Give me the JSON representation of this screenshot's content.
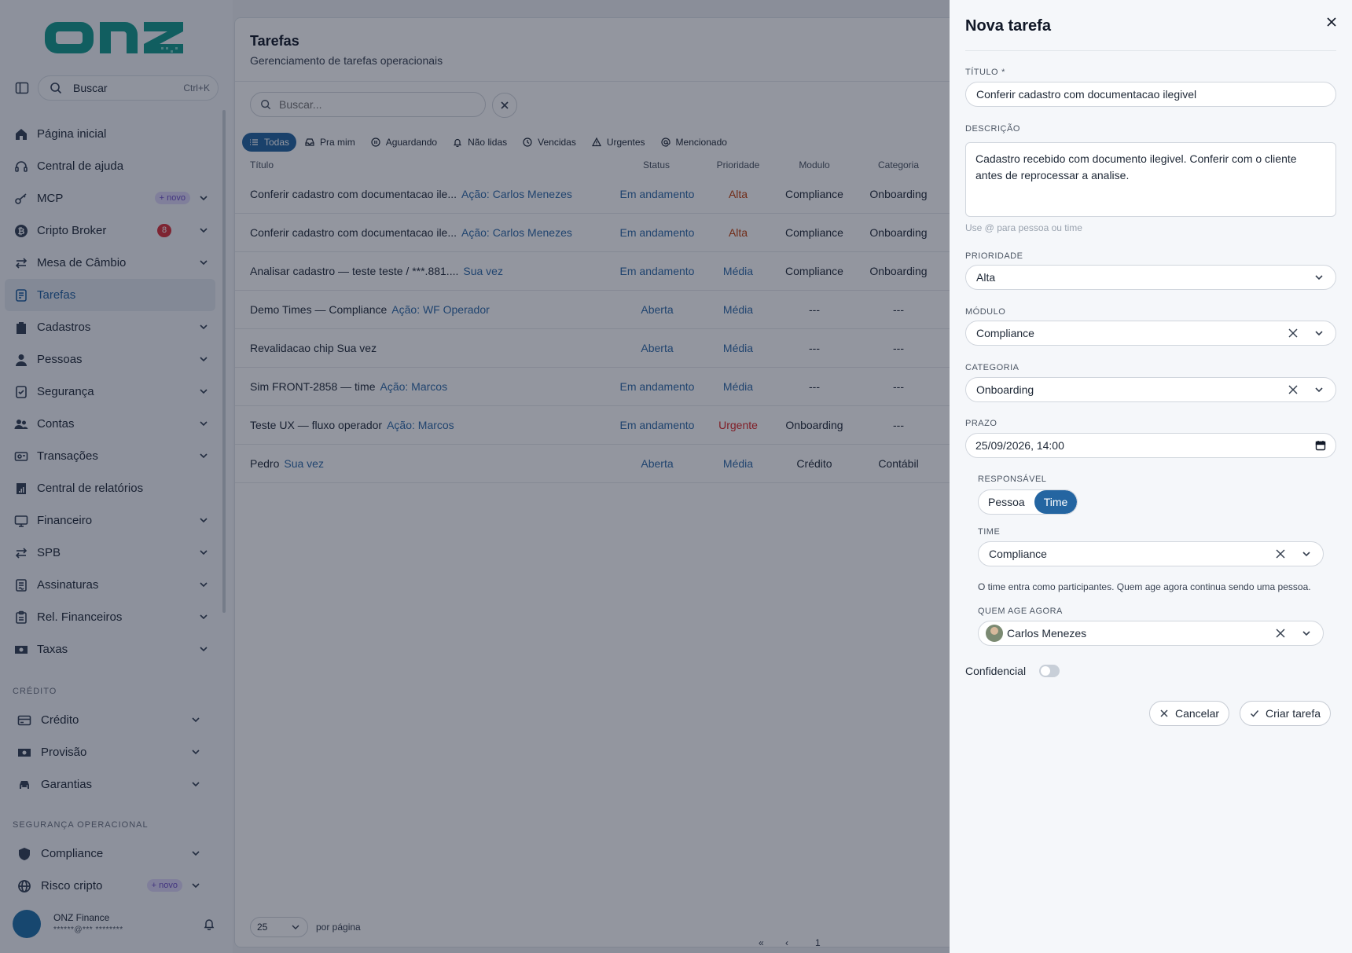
{
  "sidebar": {
    "logo_text": "onz",
    "search": {
      "label": "Buscar",
      "shortcut": "Ctrl+K"
    },
    "items": [
      {
        "label": "Página inicial",
        "icon": "home-icon"
      },
      {
        "label": "Central de ajuda",
        "icon": "headset-icon"
      },
      {
        "label": "MCP",
        "icon": "key-icon",
        "badge": "+ novo"
      },
      {
        "label": "Cripto Broker",
        "icon": "bitcoin-icon",
        "count": "8"
      },
      {
        "label": "Mesa de Câmbio",
        "icon": "swap-icon"
      },
      {
        "label": "Tarefas",
        "icon": "task-icon"
      },
      {
        "label": "Cadastros",
        "icon": "clipboard-icon"
      },
      {
        "label": "Pessoas",
        "icon": "person-icon"
      },
      {
        "label": "Segurança",
        "icon": "security-icon"
      },
      {
        "label": "Contas",
        "icon": "users-icon"
      },
      {
        "label": "Transações",
        "icon": "card-icon"
      },
      {
        "label": "Central de relatórios",
        "icon": "report-icon"
      },
      {
        "label": "Financeiro",
        "icon": "monitor-icon"
      },
      {
        "label": "SPB",
        "icon": "swap-icon"
      },
      {
        "label": "Assinaturas",
        "icon": "signature-icon"
      },
      {
        "label": "Rel. Financeiros",
        "icon": "clipboard-icon"
      },
      {
        "label": "Taxas",
        "icon": "cash-icon"
      }
    ],
    "credit_section": {
      "label": "CRÉDITO",
      "items": [
        {
          "label": "Crédito",
          "icon": "credit-card-icon"
        },
        {
          "label": "Provisão",
          "icon": "cash-icon"
        },
        {
          "label": "Garantias",
          "icon": "car-icon"
        }
      ]
    },
    "opsec_section": {
      "label": "SEGURANÇA OPERACIONAL",
      "items": [
        {
          "label": "Compliance",
          "icon": "shield-icon"
        },
        {
          "label": "Risco cripto",
          "icon": "globe-icon",
          "badge": "+ novo"
        }
      ]
    },
    "user": {
      "name": "ONZ Finance",
      "email": "******@*** ********"
    }
  },
  "main": {
    "title": "Tarefas",
    "subtitle": "Gerenciamento de tarefas operacionais",
    "search_placeholder": "Buscar...",
    "filters": [
      {
        "label": "Todas",
        "icon": "list-icon",
        "active": true
      },
      {
        "label": "Pra mim",
        "icon": "inbox-icon"
      },
      {
        "label": "Aguardando",
        "icon": "pause-icon"
      },
      {
        "label": "Não lidas",
        "icon": "bell-icon"
      },
      {
        "label": "Vencidas",
        "icon": "clock-icon"
      },
      {
        "label": "Urgentes",
        "icon": "alert-icon"
      },
      {
        "label": "Mencionado",
        "icon": "at-icon"
      }
    ],
    "table": {
      "headers": {
        "title": "Título",
        "status": "Status",
        "priority": "Prioridade",
        "module": "Modulo",
        "category": "Categoria"
      },
      "rows": [
        {
          "title": "Conferir cadastro com documentacao ile...",
          "meta": "Ação: Carlos Menezes",
          "status": "Em andamento",
          "priority": "Alta",
          "module": "Compliance",
          "category": "Onboarding"
        },
        {
          "title": "Conferir cadastro com documentacao ile...",
          "meta": "Ação: Carlos Menezes",
          "status": "Em andamento",
          "priority": "Alta",
          "module": "Compliance",
          "category": "Onboarding"
        },
        {
          "title": "Analisar cadastro — teste teste / ***.881....",
          "meta": "Sua vez",
          "status": "Em andamento",
          "priority": "Média",
          "module": "Compliance",
          "category": "Onboarding"
        },
        {
          "title": "Demo Times — Compliance",
          "meta": "Ação: WF Operador",
          "status": "Aberta",
          "priority": "Média",
          "module": "---",
          "category": "---"
        },
        {
          "title": "Revalidacao chip Sua vez",
          "meta": "",
          "status": "Aberta",
          "priority": "Média",
          "module": "---",
          "category": "---"
        },
        {
          "title": "Sim FRONT-2858 — time",
          "meta": "Ação: Marcos",
          "status": "Em andamento",
          "priority": "Média",
          "module": "---",
          "category": "---"
        },
        {
          "title": "Teste UX — fluxo operador",
          "meta": "Ação: Marcos",
          "status": "Em andamento",
          "priority": "Urgente",
          "module": "Onboarding",
          "category": "---"
        },
        {
          "title": "Pedro",
          "meta": "Sua vez",
          "status": "Aberta",
          "priority": "Média",
          "module": "Crédito",
          "category": "Contábil"
        }
      ]
    },
    "pagination": {
      "page_size": "25",
      "per_page_label": "por página",
      "first": "«",
      "prev": "‹",
      "page": "1"
    }
  },
  "drawer": {
    "title": "Nova tarefa",
    "title_label": "TÍTULO",
    "required_mark": "*",
    "title_value": "Conferir cadastro com documentacao ilegivel",
    "description_label": "DESCRIÇÃO",
    "description_value": "Cadastro recebido com documento ilegivel. Conferir com o cliente antes de reprocessar a analise.",
    "description_hint": "Use @ para pessoa ou time",
    "priority_label": "PRIORIDADE",
    "priority_value": "Alta",
    "module_label": "MÓDULO",
    "module_value": "Compliance",
    "category_label": "CATEGORIA",
    "category_value": "Onboarding",
    "deadline_label": "PRAZO",
    "deadline_value": "25/09/2026, 14:00",
    "responsible_label": "RESPONSÁVEL",
    "responsible_options": [
      "Pessoa",
      "Time"
    ],
    "responsible_selected": "Time",
    "team_label": "TIME",
    "team_value": "Compliance",
    "team_note": "O time entra como participantes. Quem age agora continua sendo uma pessoa.",
    "actor_label": "QUEM AGE AGORA",
    "actor_value": "Carlos Menezes",
    "confidential_label": "Confidencial",
    "cancel_label": "Cancelar",
    "create_label": "Criar tarefa"
  }
}
